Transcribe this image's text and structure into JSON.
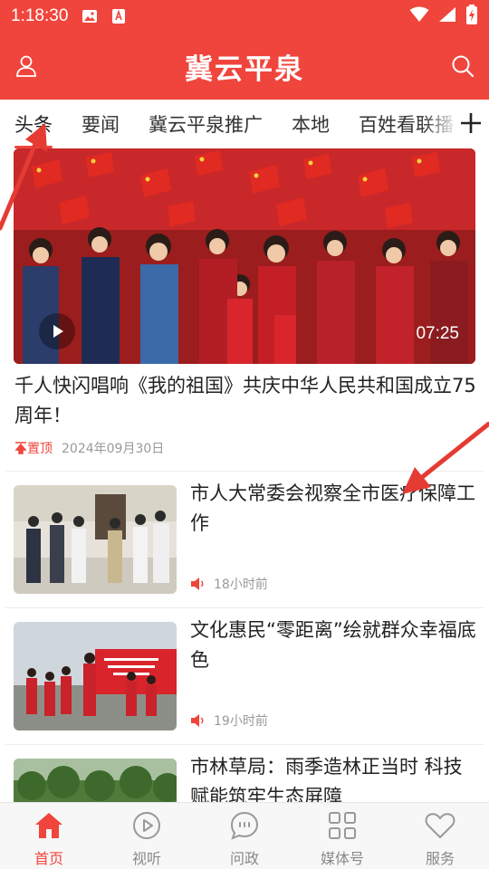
{
  "status_bar": {
    "time": "1:18:30",
    "icons": [
      "image-icon",
      "font-a-icon",
      "wifi-icon",
      "signal-icon",
      "battery-charging-icon"
    ]
  },
  "header": {
    "title": "冀云平泉",
    "left_icon": "user-icon",
    "right_icon": "search-icon"
  },
  "tabs": [
    {
      "label": "头条",
      "active": true
    },
    {
      "label": "要闻",
      "active": false
    },
    {
      "label": "冀云平泉推广",
      "active": false
    },
    {
      "label": "本地",
      "active": false
    },
    {
      "label": "百姓看联播",
      "active": false
    }
  ],
  "tabs_add_icon": "plus-icon",
  "featured": {
    "title": "千人快闪唱响《我的祖国》共庆中华人民共和国成立75周年！",
    "duration": "07:25",
    "pin_label": "置顶",
    "date": "2024年09月30日"
  },
  "news": [
    {
      "title": "市人大常委会视察全市医疗保障工作",
      "time": "18小时前"
    },
    {
      "title": "文化惠民“零距离”绘就群众幸福底色",
      "time": "19小时前"
    },
    {
      "title": "市林草局：雨季造林正当时 科技赋能筑牢生态屏障",
      "time": ""
    }
  ],
  "bottom_nav": [
    {
      "label": "首页",
      "icon": "home-icon",
      "active": true
    },
    {
      "label": "视听",
      "icon": "play-circle-icon",
      "active": false
    },
    {
      "label": "问政",
      "icon": "chat-bubble-icon",
      "active": false
    },
    {
      "label": "媒体号",
      "icon": "grid-icon",
      "active": false
    },
    {
      "label": "服务",
      "icon": "heart-icon",
      "active": false
    }
  ],
  "colors": {
    "brand": "#f0453c",
    "text": "#222222",
    "muted": "#999999"
  }
}
